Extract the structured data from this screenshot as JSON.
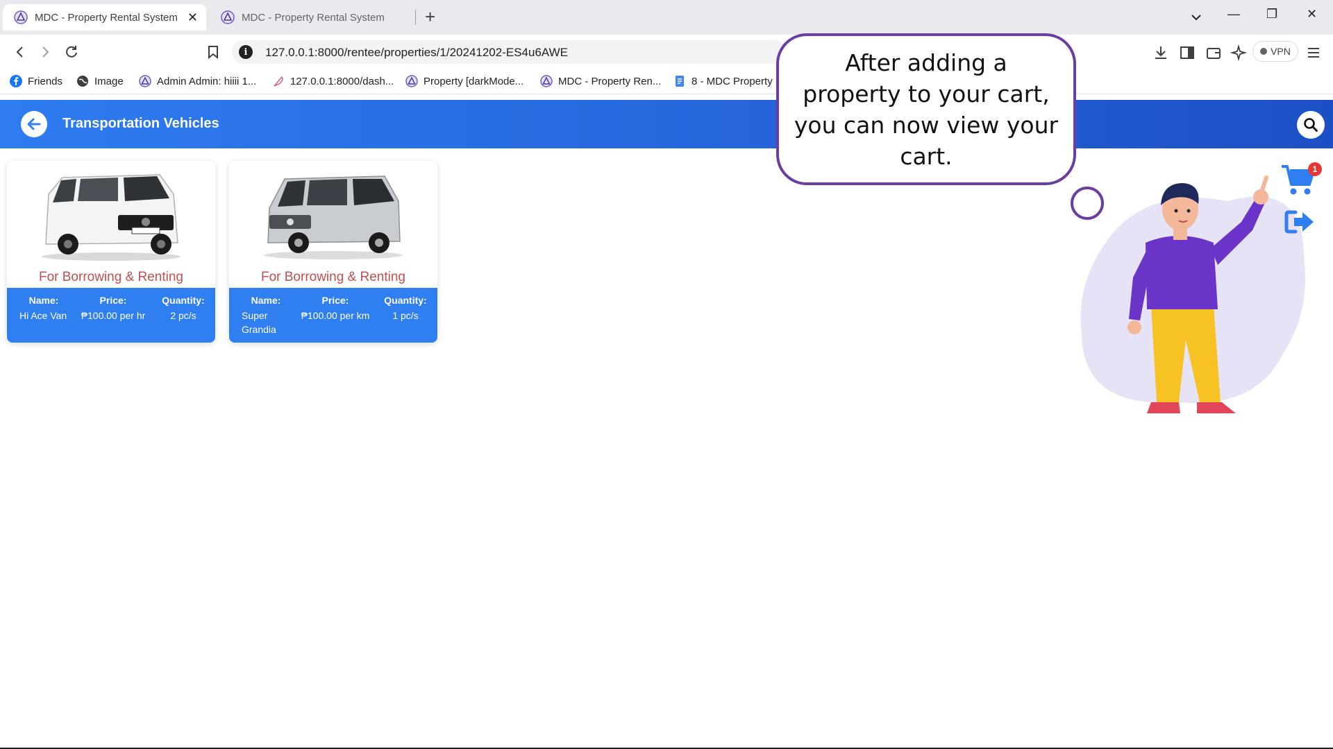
{
  "browser": {
    "tabs": [
      {
        "title": "MDC - Property Rental System",
        "active": true
      },
      {
        "title": "MDC - Property Rental System",
        "active": false
      }
    ],
    "new_tab_label": "+",
    "window_controls": {
      "minimize": "—",
      "restore": "❐",
      "close": "✕"
    },
    "url": "127.0.0.1:8000/rentee/properties/1/20241202-ES4u6AWE",
    "vpn_label": "VPN",
    "bookmarks": [
      {
        "label": "Friends",
        "icon": "facebook-icon"
      },
      {
        "label": "Image",
        "icon": "globe-icon"
      },
      {
        "label": "Admin Admin: hiiii 1...",
        "icon": "mdc-logo-icon"
      },
      {
        "label": "127.0.0.1:8000/dash...",
        "icon": "feather-icon"
      },
      {
        "label": "Property [darkMode...",
        "icon": "mdc-logo-icon"
      },
      {
        "label": "MDC - Property Ren...",
        "icon": "mdc-logo-icon"
      },
      {
        "label": "8 - MDC Property",
        "icon": "docs-icon"
      }
    ]
  },
  "page": {
    "title": "Transportation Vehicles",
    "accent_color": "#2f7ff0",
    "purpose_color": "#c0504d",
    "properties": [
      {
        "image": "white-nissan-van-photo",
        "purpose": "For Borrowing & Renting",
        "name_label": "Name:",
        "name": "Hi Ace Van",
        "price_label": "Price:",
        "price": "₱100.00 per hr",
        "quantity_label": "Quantity:",
        "quantity": "2 pc/s"
      },
      {
        "image": "silver-toyota-grandia-photo",
        "purpose": "For Borrowing & Renting",
        "name_label": "Name:",
        "name": "Super Grandia",
        "price_label": "Price:",
        "price": "₱100.00 per km",
        "quantity_label": "Quantity:",
        "quantity": "1 pc/s"
      }
    ],
    "cart_count": "1"
  },
  "tutorial": {
    "message": "After adding a property to your cart, you can now view your cart.",
    "border_color": "#6a3ea1"
  }
}
